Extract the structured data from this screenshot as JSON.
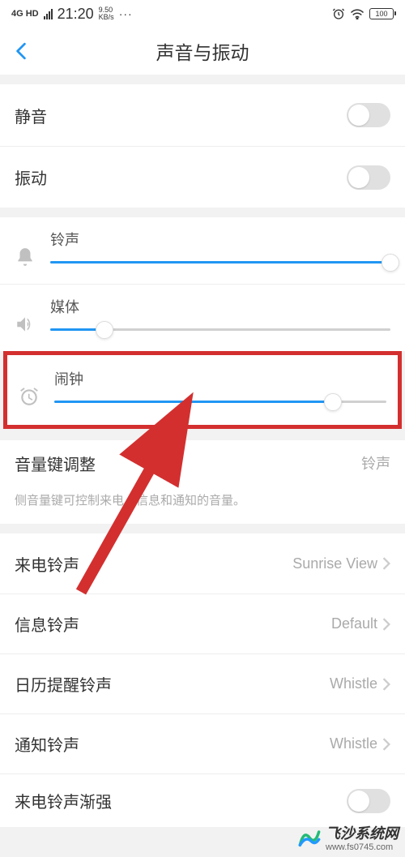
{
  "status": {
    "network": "4G HD",
    "time": "21:20",
    "speed_num": "9.50",
    "speed_unit": "KB/s",
    "dots": "···",
    "battery": "100"
  },
  "nav": {
    "title": "声音与振动"
  },
  "toggles": {
    "mute_label": "静音",
    "vibrate_label": "振动"
  },
  "sliders": {
    "ringtone": {
      "label": "铃声",
      "percent": 100
    },
    "media": {
      "label": "媒体",
      "percent": 16
    },
    "alarm": {
      "label": "闹钟",
      "percent": 84
    }
  },
  "settings": {
    "volume_key": {
      "label": "音量键调整",
      "value": "铃声"
    },
    "volume_desc": "侧音量键可控制来电、信息和通知的音量。",
    "incoming": {
      "label": "来电铃声",
      "value": "Sunrise View"
    },
    "message": {
      "label": "信息铃声",
      "value": "Default"
    },
    "calendar": {
      "label": "日历提醒铃声",
      "value": "Whistle"
    },
    "notify": {
      "label": "通知铃声",
      "value": "Whistle"
    },
    "gradual": {
      "label": "来电铃声渐强"
    }
  },
  "watermark": {
    "brand": "飞沙系统网",
    "url": "www.fs0745.com"
  }
}
